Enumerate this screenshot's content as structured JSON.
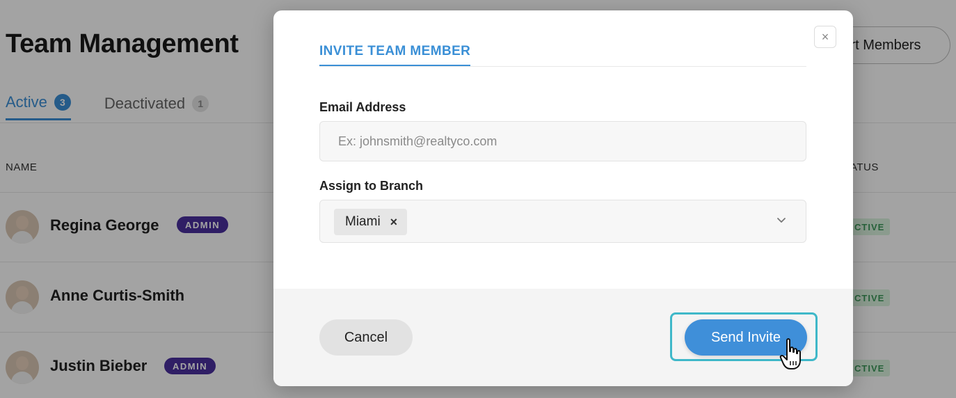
{
  "page": {
    "title": "Team Management",
    "top_button_label": "rt Members",
    "tabs": [
      {
        "label": "Active",
        "count": "3"
      },
      {
        "label": "Deactivated",
        "count": "1"
      }
    ],
    "table": {
      "headers": {
        "name": "NAME",
        "status": "ATUS"
      },
      "rows": [
        {
          "name": "Regina George",
          "badge": "ADMIN",
          "status": "CTIVE"
        },
        {
          "name": "Anne Curtis-Smith",
          "badge": "",
          "status": "CTIVE"
        },
        {
          "name": "Justin Bieber",
          "badge": "ADMIN",
          "status": "CTIVE"
        }
      ]
    }
  },
  "modal": {
    "close_label": "×",
    "tab_label": "INVITE TEAM MEMBER",
    "email": {
      "label": "Email Address",
      "placeholder": "Ex: johnsmith@realtyco.com",
      "value": ""
    },
    "branch": {
      "label": "Assign to Branch",
      "selected_chip": "Miami",
      "chip_remove": "×"
    },
    "cancel_label": "Cancel",
    "send_label": "Send Invite"
  },
  "colors": {
    "accent": "#3a8fd6",
    "admin_badge": "#4a2f9e",
    "focus_ring": "#3fb8c9",
    "status_active_bg": "#d9f2df"
  },
  "icons": {
    "close": "close-icon",
    "chip_remove": "remove-chip-icon",
    "dropdown": "chevron-down-icon",
    "cursor": "hand-pointer-icon"
  }
}
